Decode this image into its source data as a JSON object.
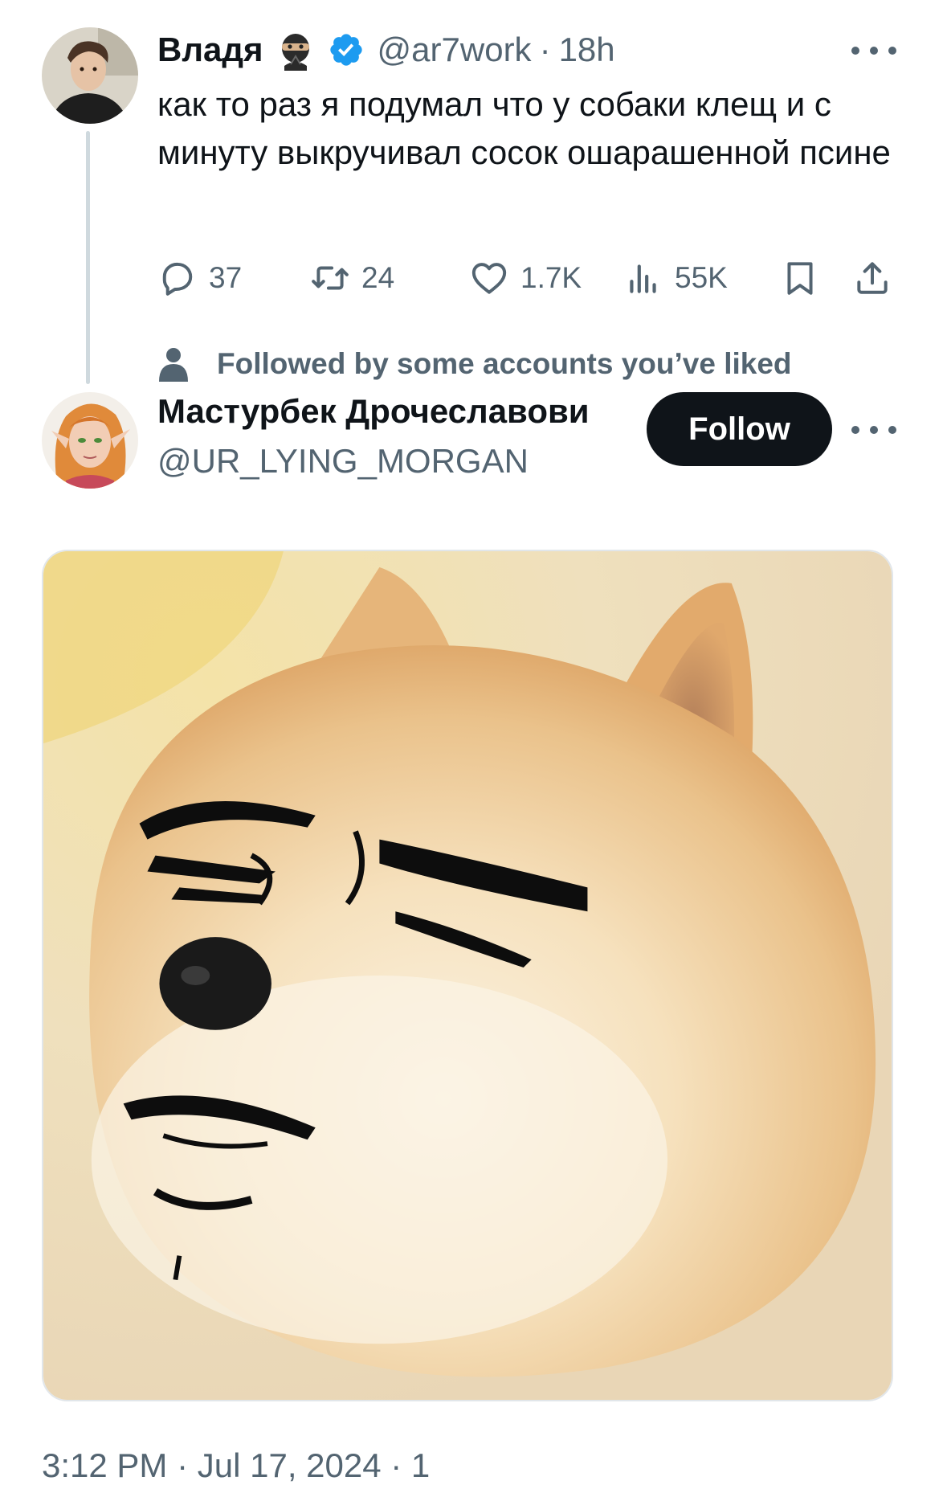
{
  "tweet": {
    "author_name": "Владя",
    "emoji": "ninja-emoji",
    "verified": true,
    "handle": "@ar7work",
    "separator": "·",
    "time": "18h",
    "text": "как то раз я подумал что у собаки клещ и с минуту выкручивал сосок ошарашенной псине",
    "actions": {
      "replies": "37",
      "retweets": "24",
      "likes": "1.7K",
      "views": "55K"
    }
  },
  "social_context": {
    "icon": "person-icon",
    "text": "Followed by some accounts you’ve liked"
  },
  "reply": {
    "author_name": "Мастурбек Дрочеславови",
    "handle": "@UR_LYING_MORGAN",
    "follow_label": "Follow",
    "media": {
      "kind": "doge-meme-image"
    },
    "footer_partial": "3:12 PM · Jul 17, 2024 · 1"
  },
  "colors": {
    "text_primary": "#0f1419",
    "text_secondary": "#536471",
    "verified_blue": "#1d9bf0",
    "follow_button_bg": "#0f1419",
    "thread_line": "#cfd9de"
  }
}
